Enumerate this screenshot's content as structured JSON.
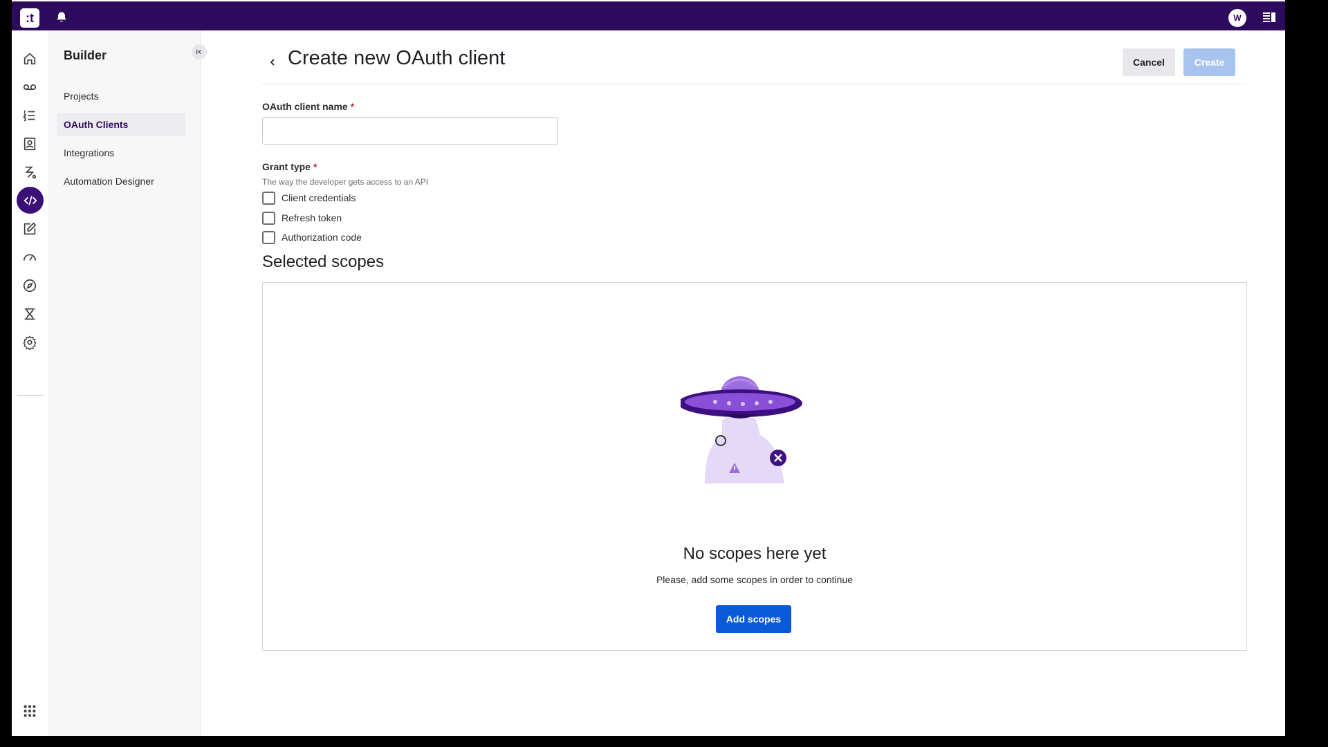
{
  "topbar": {
    "logo_text": ":t",
    "avatar_initial": "W",
    "icons": [
      "bell-icon",
      "panel-toggle-icon"
    ]
  },
  "rail": {
    "items": [
      "home-icon",
      "voicemail-icon",
      "list-icon",
      "contacts-icon",
      "flow-icon",
      "code-icon",
      "edit-icon",
      "dashboard-icon",
      "compass-icon",
      "dna-icon",
      "settings-icon"
    ],
    "active": "code-icon",
    "bottom_icon": "apps-grid-icon"
  },
  "sidebar": {
    "title": "Builder",
    "items": [
      {
        "label": "Projects"
      },
      {
        "label": "OAuth Clients"
      },
      {
        "label": "Integrations"
      },
      {
        "label": "Automation Designer"
      }
    ],
    "active_index": 1
  },
  "header": {
    "title": "Create new OAuth client",
    "cancel_label": "Cancel",
    "create_label": "Create"
  },
  "form": {
    "name_label": "OAuth client name",
    "required_mark": "*",
    "name_value": "",
    "grant_label": "Grant type",
    "grant_help": "The way the developer gets access to an API",
    "grant_options": [
      {
        "label": "Client credentials",
        "checked": false
      },
      {
        "label": "Refresh token",
        "checked": false
      },
      {
        "label": "Authorization code",
        "checked": false
      }
    ]
  },
  "scopes": {
    "title": "Selected scopes",
    "empty_title": "No scopes here yet",
    "empty_subtitle": "Please, add some scopes in order to continue",
    "add_label": "Add scopes"
  },
  "colors": {
    "topbar": "#2e0a5c",
    "active_rail": "#3b0f78",
    "primary_button": "#0a5ad7",
    "disabled_button": "#a9c3ef",
    "required": "#c0242d"
  }
}
